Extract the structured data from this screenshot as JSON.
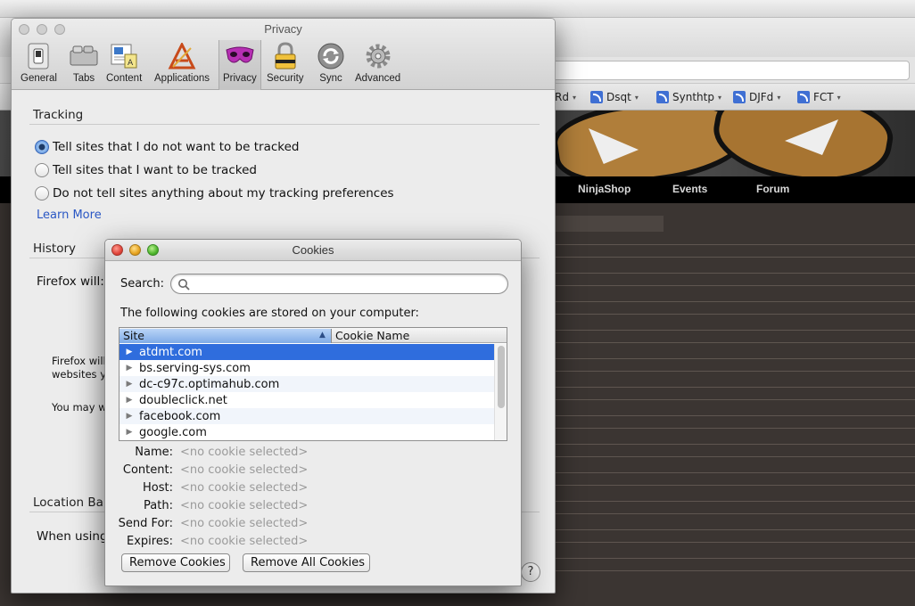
{
  "background_browser": {
    "bookmarks": [
      {
        "label": "Rd",
        "arrow": "▾"
      },
      {
        "label": "Dsqt",
        "arrow": "▾"
      },
      {
        "label": "Synthtp",
        "arrow": "▾"
      },
      {
        "label": "DJFd",
        "arrow": "▾"
      },
      {
        "label": "FCT",
        "arrow": "▾"
      }
    ],
    "nav_links": [
      "NinjaShop",
      "Events",
      "Forum"
    ]
  },
  "prefs_window": {
    "title": "Privacy",
    "toolbar": [
      {
        "label": "General",
        "icon": "switch-icon"
      },
      {
        "label": "Tabs",
        "icon": "tabs-icon"
      },
      {
        "label": "Content",
        "icon": "content-icon"
      },
      {
        "label": "Applications",
        "icon": "applications-icon"
      },
      {
        "label": "Privacy",
        "icon": "mask-icon",
        "selected": true
      },
      {
        "label": "Security",
        "icon": "lock-icon"
      },
      {
        "label": "Sync",
        "icon": "sync-icon"
      },
      {
        "label": "Advanced",
        "icon": "gear-icon"
      }
    ],
    "tracking": {
      "heading": "Tracking",
      "options": [
        {
          "label": "Tell sites that I do not want to be tracked",
          "checked": true
        },
        {
          "label": "Tell sites that I want to be tracked",
          "checked": false
        },
        {
          "label": "Do not tell sites anything about my tracking preferences",
          "checked": false
        }
      ],
      "learn_more": "Learn More"
    },
    "history": {
      "heading": "History",
      "firefox_will": "Firefox will:",
      "partial_text_1": "Firefox will",
      "partial_text_2": "websites yo",
      "partial_text_3": "You may wa"
    },
    "location_bar": {
      "heading": "Location Bar",
      "when_using": "When using"
    },
    "help": "?"
  },
  "cookies_dialog": {
    "title": "Cookies",
    "search": {
      "label": "Search:",
      "value": "",
      "placeholder": ""
    },
    "stored_text": "The following cookies are stored on your computer:",
    "columns": [
      "Site",
      "Cookie Name"
    ],
    "sort_indicator": "▲",
    "sites": [
      {
        "name": "atdmt.com",
        "selected": true
      },
      {
        "name": "bs.serving-sys.com",
        "selected": false
      },
      {
        "name": "dc-c97c.optimahub.com",
        "selected": false
      },
      {
        "name": "doubleclick.net",
        "selected": false
      },
      {
        "name": "facebook.com",
        "selected": false
      },
      {
        "name": "google.com",
        "selected": false
      }
    ],
    "details": [
      {
        "label": "Name:",
        "value": "<no cookie selected>"
      },
      {
        "label": "Content:",
        "value": "<no cookie selected>"
      },
      {
        "label": "Host:",
        "value": "<no cookie selected>"
      },
      {
        "label": "Path:",
        "value": "<no cookie selected>"
      },
      {
        "label": "Send For:",
        "value": "<no cookie selected>"
      },
      {
        "label": "Expires:",
        "value": "<no cookie selected>"
      }
    ],
    "buttons": {
      "remove": "Remove Cookies",
      "remove_all": "Remove All Cookies"
    }
  }
}
